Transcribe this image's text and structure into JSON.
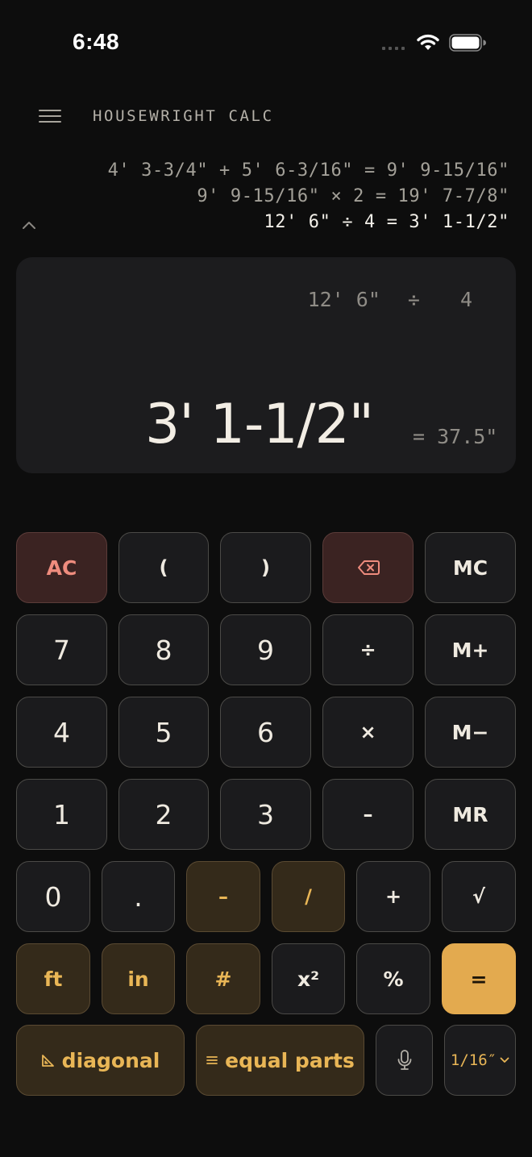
{
  "status_bar": {
    "time": "6:48"
  },
  "app": {
    "title": "HOUSEWRIGHT CALC"
  },
  "history": [
    {
      "text": "4' 3-3/4\" + 5' 6-3/16\" = 9' 9-15/16\""
    },
    {
      "text": "9' 9-15/16\" × 2 = 19' 7-7/8\""
    },
    {
      "text": "12' 6\" ÷ 4 = 3' 1-1/2\""
    }
  ],
  "display": {
    "operand1": "12' 6\"",
    "operator": "÷",
    "operand2": "4",
    "result": "3' 1-1/2\"",
    "decimal": "= 37.5\""
  },
  "keys": {
    "ac": "AC",
    "lparen": "(",
    "rparen": ")",
    "mc": "MC",
    "seven": "7",
    "eight": "8",
    "nine": "9",
    "divide": "÷",
    "mplus": "M+",
    "four": "4",
    "five": "5",
    "six": "6",
    "multiply": "×",
    "mminus": "M−",
    "one": "1",
    "two": "2",
    "three": "3",
    "subtract": "–",
    "mr": "MR",
    "zero": "0",
    "dot": ".",
    "dash": "–",
    "slash": "/",
    "add": "+",
    "sqrt": "√",
    "ft": "ft",
    "inch": "in",
    "hash": "#",
    "square": "x²",
    "percent": "%",
    "equals": "=",
    "diagonal": "diagonal",
    "equal_parts": "equal parts",
    "precision": "1/16″"
  },
  "colors": {
    "background": "#0d0d0d",
    "display": "#1c1c1e",
    "accent": "#e3aa4f",
    "amber_text": "#e9b656",
    "danger_text": "#ef8c7e"
  },
  "icons": [
    "menu-icon",
    "chevron-up-icon",
    "backspace-icon",
    "ruler-triangle-icon",
    "equal-parts-icon",
    "microphone-icon",
    "chevron-down-icon",
    "wifi-icon",
    "battery-icon",
    "signal-icon"
  ]
}
